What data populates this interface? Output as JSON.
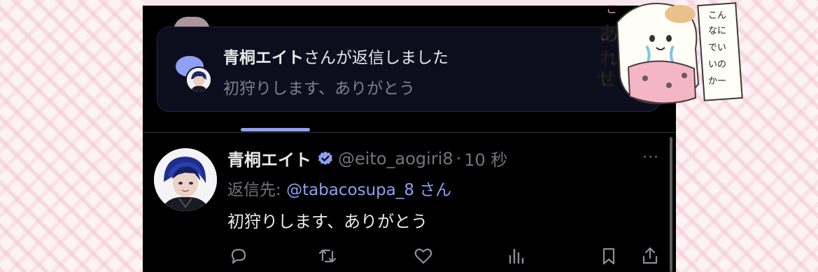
{
  "notification": {
    "name": "青桐エイト",
    "title_suffix": "さんが返信しました",
    "body": "初狩りします、ありがとう"
  },
  "tweet": {
    "name": "青桐エイト",
    "handle": "@eito_aogiri8",
    "separator": "·",
    "time": "10 秒",
    "reply_label": "返信先: ",
    "reply_handle": "@tabacosupa_8 さん",
    "text": "初狩りします、ありがとう",
    "verified_icon": "verified-badge-icon",
    "more_label": "···"
  },
  "actions": [
    "reply-icon",
    "retweet-icon",
    "like-icon",
    "analytics-icon",
    "bookmark-icon",
    "share-icon"
  ],
  "sticker": {
    "text_left": "あれせ",
    "text_right": "こんなにでいいのかー"
  },
  "colors": {
    "accent": "#8e9ff4",
    "background": "#000000",
    "muted": "#71767b",
    "text": "#e7e9ea",
    "verified": "#8e9ff4"
  }
}
